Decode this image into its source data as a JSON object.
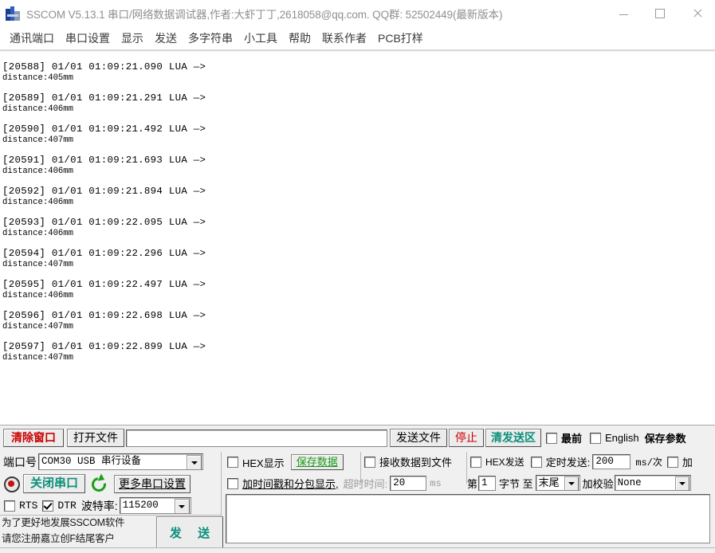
{
  "window": {
    "title": "SSCOM V5.13.1 串口/网络数据调试器,作者:大虾丁丁,2618058@qq.com. QQ群: 52502449(最新版本)",
    "icon": "sscom-app-icon",
    "minimize": "—",
    "maximize": "□",
    "close": "✕"
  },
  "menu": {
    "items": [
      {
        "label": "通讯端口"
      },
      {
        "label": "串口设置"
      },
      {
        "label": "显示"
      },
      {
        "label": "发送"
      },
      {
        "label": "多字符串"
      },
      {
        "label": "小工具"
      },
      {
        "label": "帮助"
      },
      {
        "label": "联系作者"
      },
      {
        "label": "PCB打样"
      }
    ]
  },
  "terminal": {
    "entries": [
      {
        "head": "[20588] 01/01 01:09:21.090 LUA —>",
        "body": "distance:405mm"
      },
      {
        "head": "[20589] 01/01 01:09:21.291 LUA —>",
        "body": "distance:406mm"
      },
      {
        "head": "[20590] 01/01 01:09:21.492 LUA —>",
        "body": "distance:407mm"
      },
      {
        "head": "[20591] 01/01 01:09:21.693 LUA —>",
        "body": "distance:406mm"
      },
      {
        "head": "[20592] 01/01 01:09:21.894 LUA —>",
        "body": "distance:406mm"
      },
      {
        "head": "[20593] 01/01 01:09:22.095 LUA —>",
        "body": "distance:406mm"
      },
      {
        "head": "[20594] 01/01 01:09:22.296 LUA —>",
        "body": "distance:407mm"
      },
      {
        "head": "[20595] 01/01 01:09:22.497 LUA —>",
        "body": "distance:406mm"
      },
      {
        "head": "[20596] 01/01 01:09:22.698 LUA —>",
        "body": "distance:407mm"
      },
      {
        "head": "[20597] 01/01 01:09:22.899 LUA —>",
        "body": "distance:407mm"
      }
    ]
  },
  "toolbar": {
    "clear_window": "清除窗口",
    "open_file": "打开文件",
    "file_path_value": "",
    "send_file": "发送文件",
    "stop": "停止",
    "clear_send": "清发送区",
    "topmost_label": "最前",
    "topmost_checked": false,
    "english_label": "English",
    "english_checked": false,
    "save_params": "保存参数"
  },
  "port": {
    "port_label": "端口号",
    "port_value": "COM30 USB 串行设备",
    "close_port": "关闭串口",
    "refresh_icon": "refresh-icon",
    "status_icon": "port-status-icon",
    "more_settings": "更多串口设置",
    "rts_label": "RTS",
    "rts_checked": false,
    "dtr_label": "DTR",
    "dtr_checked": true,
    "baud_label": "波特率:",
    "baud_value": "115200"
  },
  "receive": {
    "hex_display_label": "HEX显示",
    "hex_display_checked": false,
    "save_data": "保存数据",
    "save_to_file_label": "接收数据到文件",
    "save_to_file_checked": false,
    "timestamp_label": "加时间戳和分包显示,",
    "timestamp_checked": false,
    "timeout_label": "超时时间:",
    "timeout_value": "20",
    "timeout_unit": "ms"
  },
  "send": {
    "hex_send_label": "HEX发送",
    "hex_send_checked": false,
    "timed_send_label": "定时发送:",
    "timed_send_checked": false,
    "interval_value": "200",
    "interval_unit": "ms/次",
    "add_label": "加",
    "add_checked": false,
    "byte_prefix": "第",
    "byte_start": "1",
    "byte_mid": "字节 至",
    "byte_end": "末尾",
    "checksum_label": "加校验",
    "checksum_value": "None",
    "send_text_value": "",
    "send_button": "发 送"
  },
  "promo": {
    "line1": "为了更好地发展SSCOM软件",
    "line2": "请您注册嘉立创F结尾客户"
  }
}
